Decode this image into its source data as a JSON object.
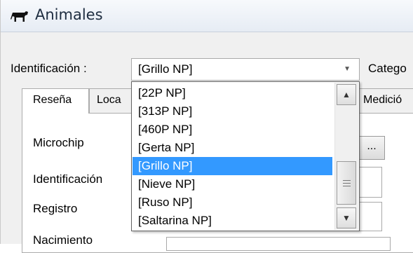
{
  "window": {
    "title": "Animales",
    "icon": "cow-icon"
  },
  "header": {
    "identificacion_label": "Identificación :",
    "identificacion_value": "[Grillo  NP]",
    "categoria_label_partial": "Catego"
  },
  "tabs": [
    {
      "label": "Reseña",
      "active": true
    },
    {
      "label": "Loca",
      "active": false
    },
    {
      "label": "Medició",
      "active": false
    }
  ],
  "form": {
    "microchip_label": "Microchip",
    "identificacion_label": "Identificación",
    "registro_label": "Registro",
    "nacimiento_label_partial": "Nacimiento",
    "ellipsis_label": "..."
  },
  "dropdown": {
    "items": [
      {
        "label": "[22P  NP]",
        "selected": false
      },
      {
        "label": "[313P  NP]",
        "selected": false
      },
      {
        "label": "[460P  NP]",
        "selected": false
      },
      {
        "label": "[Gerta  NP]",
        "selected": false
      },
      {
        "label": "[Grillo  NP]",
        "selected": true
      },
      {
        "label": "[Nieve  NP]",
        "selected": false
      },
      {
        "label": "[Ruso  NP]",
        "selected": false
      },
      {
        "label": "[Saltarina  NP]",
        "selected": false
      }
    ],
    "selected_color": "#3399ff"
  }
}
